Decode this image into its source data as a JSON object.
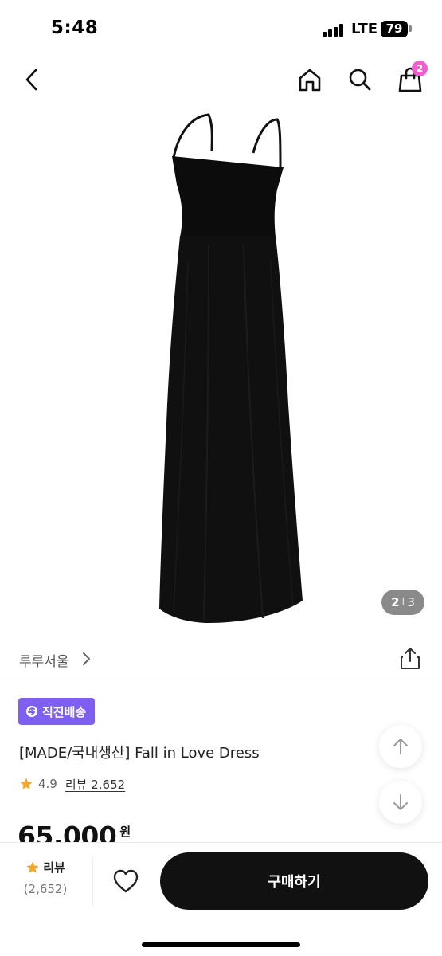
{
  "status_bar": {
    "time": "5:48",
    "network": "LTE",
    "battery": "79"
  },
  "nav": {
    "back_icon": "chevron-left-icon",
    "home_icon": "home-icon",
    "search_icon": "search-icon",
    "cart_icon": "shopping-bag-icon",
    "cart_count": "2",
    "badge_color": "#ee5fd0"
  },
  "gallery": {
    "current": "2",
    "separator": "I",
    "total": "3"
  },
  "brand": {
    "name": "루루서울",
    "share_icon": "share-icon"
  },
  "product": {
    "delivery_badge": "직진배송",
    "badge_color": "#7e5ff2",
    "title": "[MADE/국내생산] Fall in Love Dress",
    "rating": "4.9",
    "review_link": "리뷰 2,652",
    "price": "65,000",
    "price_unit": "원"
  },
  "bottom_bar": {
    "review_label": "리뷰",
    "review_count": "(2,652)",
    "like_icon": "heart-icon",
    "buy_label": "구매하기"
  }
}
